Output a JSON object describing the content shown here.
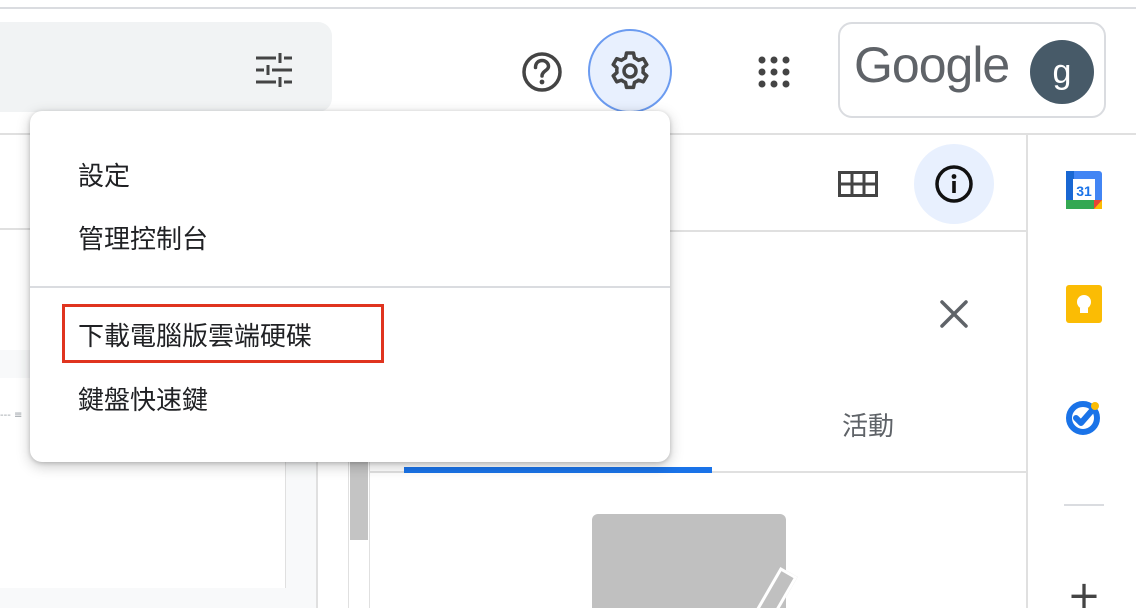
{
  "header": {
    "help_icon": "help-circle-icon",
    "settings_icon": "gear-icon",
    "apps_icon": "apps-grid-icon",
    "account": {
      "wordmark": "Google",
      "avatar_letter": "g"
    }
  },
  "settings_menu": {
    "items": [
      {
        "label": "設定"
      },
      {
        "label": "管理控制台"
      },
      {
        "label": "下載電腦版雲端硬碟"
      },
      {
        "label": "鍵盤快速鍵"
      }
    ],
    "highlighted_index": 2
  },
  "details_panel": {
    "tab_activity": "活動",
    "active_tab": 0
  },
  "side_panel": {
    "apps": [
      {
        "name": "calendar",
        "label": "31"
      },
      {
        "name": "keep"
      },
      {
        "name": "tasks"
      }
    ],
    "add_label": "+"
  },
  "colors": {
    "accent": "#1a73e8",
    "highlight_border": "#e0341f",
    "avatar_bg": "#475a68",
    "settings_active_bg": "#e8f0fe"
  }
}
